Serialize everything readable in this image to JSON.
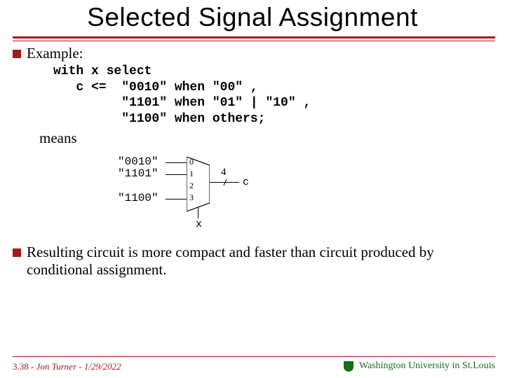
{
  "title": "Selected Signal Assignment",
  "bullets": {
    "example_label": "Example:",
    "result_text": "Resulting circuit is more compact and faster than circuit produced by conditional assignment."
  },
  "code": {
    "line1": "with x select",
    "line2": "   c <=  \"0010\" when \"00\" ,",
    "line3": "         \"1101\" when \"01\" | \"10\" ,",
    "line4": "         \"1100\" when others;"
  },
  "means": "means",
  "diagram": {
    "in0": "\"0010\"",
    "in1": "\"1101\"",
    "in3": "\"1100\"",
    "ports": {
      "p0": "0",
      "p1": "1",
      "p2": "2",
      "p3": "3"
    },
    "bus_width": "4",
    "out_label": "c",
    "select_label": "x"
  },
  "footer": {
    "page": "3.38",
    "author": "Jon Turner",
    "date": "1/29/2022",
    "univ": "Washington University in St.Louis"
  }
}
